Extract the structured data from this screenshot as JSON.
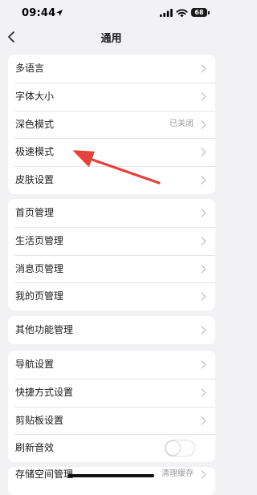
{
  "status_bar": {
    "time": "09:44",
    "battery": "68"
  },
  "nav": {
    "title": "通用"
  },
  "groups": [
    {
      "items": [
        {
          "label": "多语言",
          "value": ""
        },
        {
          "label": "字体大小",
          "value": ""
        },
        {
          "label": "深色模式",
          "value": "已关闭"
        },
        {
          "label": "极速模式",
          "value": ""
        },
        {
          "label": "皮肤设置",
          "value": ""
        }
      ]
    },
    {
      "items": [
        {
          "label": "首页管理",
          "value": ""
        },
        {
          "label": "生活页管理",
          "value": ""
        },
        {
          "label": "消息页管理",
          "value": ""
        },
        {
          "label": "我的页管理",
          "value": ""
        }
      ]
    },
    {
      "items": [
        {
          "label": "其他功能管理",
          "value": ""
        }
      ]
    },
    {
      "items": [
        {
          "label": "导航设置",
          "value": ""
        },
        {
          "label": "快捷方式设置",
          "value": ""
        },
        {
          "label": "剪贴板设置",
          "value": ""
        },
        {
          "label": "刷新音效",
          "toggle": false
        }
      ]
    },
    {
      "items": [
        {
          "label": "存储空间管理",
          "value": "清理缓存"
        }
      ]
    }
  ],
  "colors": {
    "background": "#f2f2f4",
    "card": "#ffffff",
    "annotation_arrow": "#e8403a",
    "secondary_text": "#9a9a9e"
  }
}
